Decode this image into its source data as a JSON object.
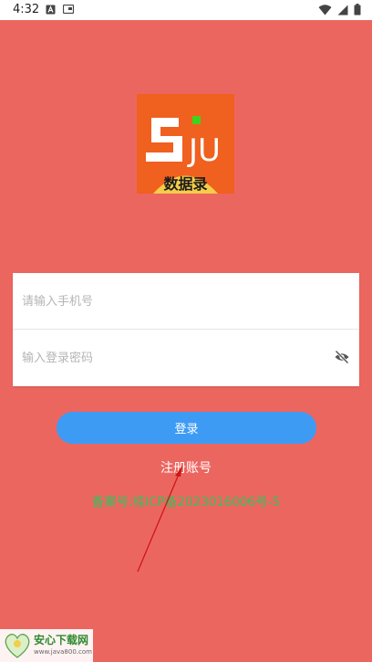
{
  "status_bar": {
    "time": "4:32",
    "left_icons": [
      "text-a-icon",
      "card-icon"
    ],
    "right_icons": [
      "wifi-icon",
      "signal-icon",
      "battery-icon"
    ]
  },
  "logo": {
    "brand_letters": "JU",
    "brand_caption": "数据录",
    "colors": {
      "orange": "#f0601f",
      "yellow": "#f5cd4a",
      "green": "#41d11f"
    }
  },
  "login_form": {
    "phone_placeholder": "请输入手机号",
    "password_placeholder": "输入登录密码"
  },
  "login_button": {
    "label": "登录",
    "color": "#3d9bf4"
  },
  "register_link": {
    "label": "注册账号"
  },
  "icp": {
    "text": "备案号:桂ICP备2023016006号-5",
    "color": "#31c35a"
  },
  "watermark": {
    "text": "安心下载网",
    "url": "www.java800.com"
  },
  "colors": {
    "background": "#ec6660",
    "card": "#ffffff"
  }
}
